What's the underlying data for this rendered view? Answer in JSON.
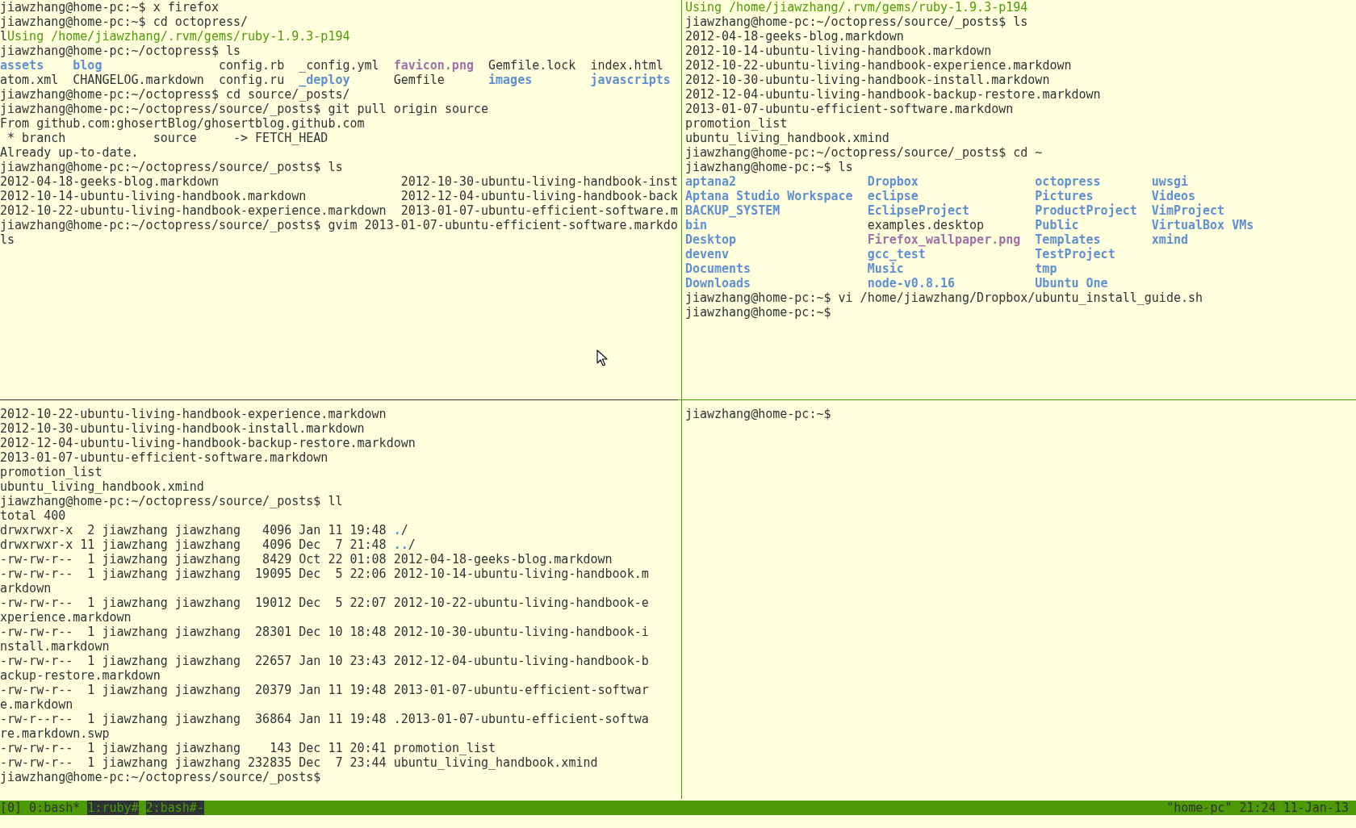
{
  "panes": {
    "top_left": [
      {
        "segments": [
          {
            "text": "jiawzhang@home-pc:~$ x firefox",
            "kind": "plain"
          }
        ]
      },
      {
        "segments": [
          {
            "text": "jiawzhang@home-pc:~$ cd octopress/",
            "kind": "plain"
          }
        ]
      },
      {
        "segments": [
          {
            "text": "l",
            "kind": "plain"
          },
          {
            "text": "Using /home/jiawzhang/.rvm/gems/ruby-1.9.3-p194",
            "kind": "ruby"
          }
        ]
      },
      {
        "segments": [
          {
            "text": "jiawzhang@home-pc:~/octopress$ ls",
            "kind": "plain"
          }
        ]
      },
      {
        "columns": [
          [
            {
              "text": "assets",
              "kind": "dir"
            },
            {
              "text": "atom.xml",
              "kind": "file"
            }
          ],
          [
            {
              "text": "blog",
              "kind": "dir"
            },
            {
              "text": "CHANGELOG.markdown",
              "kind": "file"
            }
          ],
          [
            {
              "text": "config.rb",
              "kind": "file"
            },
            {
              "text": "config.ru",
              "kind": "file"
            }
          ],
          [
            {
              "text": "_config.yml",
              "kind": "file"
            },
            {
              "text": "_deploy",
              "kind": "dir"
            }
          ],
          [
            {
              "text": "favicon.png",
              "kind": "image"
            },
            {
              "text": "Gemfile",
              "kind": "file"
            }
          ],
          [
            {
              "text": "Gemfile.lock",
              "kind": "file"
            },
            {
              "text": "images",
              "kind": "dir"
            }
          ],
          [
            {
              "text": "index.html",
              "kind": "file"
            },
            {
              "text": "javascripts",
              "kind": "dir"
            }
          ]
        ]
      },
      {
        "segments": [
          {
            "text": "jiawzhang@home-pc:~/octopress$ cd source/_posts/",
            "kind": "plain"
          }
        ]
      },
      {
        "segments": [
          {
            "text": "jiawzhang@home-pc:~/octopress/source/_posts$ git pull origin source",
            "kind": "plain"
          }
        ]
      },
      {
        "segments": [
          {
            "text": "From github.com:ghosertBlog/ghosertblog.github.com",
            "kind": "plain"
          }
        ]
      },
      {
        "segments": [
          {
            "text": " * branch            source     -> FETCH_HEAD",
            "kind": "plain"
          }
        ]
      },
      {
        "segments": [
          {
            "text": "Already up-to-date.",
            "kind": "plain"
          }
        ]
      },
      {
        "segments": [
          {
            "text": "jiawzhang@home-pc:~/octopress/source/_posts$ ls",
            "kind": "plain"
          }
        ]
      },
      {
        "columns": [
          [
            {
              "text": "2012-04-18-geeks-blog.markdown",
              "kind": "file"
            },
            {
              "text": "2012-10-14-ubuntu-living-handbook.markdown",
              "kind": "file"
            },
            {
              "text": "2012-10-22-ubuntu-living-handbook-experience.markdown",
              "kind": "file"
            }
          ],
          [
            {
              "text": "2012-10-30-ubuntu-living-handbook-inst",
              "kind": "file"
            },
            {
              "text": "2012-12-04-ubuntu-living-handbook-back",
              "kind": "file"
            },
            {
              "text": "2013-01-07-ubuntu-efficient-software.m",
              "kind": "file"
            }
          ]
        ]
      },
      {
        "segments": [
          {
            "text": "jiawzhang@home-pc:~/octopress/source/_posts$ gvim 2013-01-07-ubuntu-efficient-software.markdo",
            "kind": "plain"
          }
        ]
      },
      {
        "segments": [
          {
            "text": "ls",
            "kind": "plain"
          }
        ]
      }
    ],
    "top_right": [
      {
        "segments": [
          {
            "text": "Using /home/jiawzhang/.rvm/gems/ruby-1.9.3-p194",
            "kind": "ruby"
          }
        ]
      },
      {
        "segments": [
          {
            "text": "jiawzhang@home-pc:~/octopress/source/_posts$ ls",
            "kind": "plain"
          }
        ]
      },
      {
        "segments": [
          {
            "text": "2012-04-18-geeks-blog.markdown",
            "kind": "plain"
          }
        ]
      },
      {
        "segments": [
          {
            "text": "2012-10-14-ubuntu-living-handbook.markdown",
            "kind": "plain"
          }
        ]
      },
      {
        "segments": [
          {
            "text": "2012-10-22-ubuntu-living-handbook-experience.markdown",
            "kind": "plain"
          }
        ]
      },
      {
        "segments": [
          {
            "text": "2012-10-30-ubuntu-living-handbook-install.markdown",
            "kind": "plain"
          }
        ]
      },
      {
        "segments": [
          {
            "text": "2012-12-04-ubuntu-living-handbook-backup-restore.markdown",
            "kind": "plain"
          }
        ]
      },
      {
        "segments": [
          {
            "text": "2013-01-07-ubuntu-efficient-software.markdown",
            "kind": "plain"
          }
        ]
      },
      {
        "segments": [
          {
            "text": "promotion_list",
            "kind": "plain"
          }
        ]
      },
      {
        "segments": [
          {
            "text": "ubuntu_living_handbook.xmind",
            "kind": "plain"
          }
        ]
      },
      {
        "segments": [
          {
            "text": "jiawzhang@home-pc:~/octopress/source/_posts$ cd ~",
            "kind": "plain"
          }
        ]
      },
      {
        "segments": [
          {
            "text": "jiawzhang@home-pc:~$ ls",
            "kind": "plain"
          }
        ]
      },
      {
        "columns": [
          [
            {
              "text": "aptana2",
              "kind": "dir"
            },
            {
              "text": "Aptana Studio Workspace",
              "kind": "dir"
            },
            {
              "text": "BACKUP_SYSTEM",
              "kind": "dir"
            },
            {
              "text": "bin",
              "kind": "dir"
            },
            {
              "text": "Desktop",
              "kind": "dir"
            },
            {
              "text": "devenv",
              "kind": "dir"
            },
            {
              "text": "Documents",
              "kind": "dir"
            },
            {
              "text": "Downloads",
              "kind": "dir"
            }
          ],
          [
            {
              "text": "Dropbox",
              "kind": "dir"
            },
            {
              "text": "eclipse",
              "kind": "dir"
            },
            {
              "text": "EclipseProject",
              "kind": "dir"
            },
            {
              "text": "examples.desktop",
              "kind": "file"
            },
            {
              "text": "Firefox_wallpaper.png",
              "kind": "image"
            },
            {
              "text": "gcc_test",
              "kind": "dir"
            },
            {
              "text": "Music",
              "kind": "dir"
            },
            {
              "text": "node-v0.8.16",
              "kind": "dir"
            }
          ],
          [
            {
              "text": "octopress",
              "kind": "dir"
            },
            {
              "text": "Pictures",
              "kind": "dir"
            },
            {
              "text": "ProductProject",
              "kind": "dir"
            },
            {
              "text": "Public",
              "kind": "dir"
            },
            {
              "text": "Templates",
              "kind": "dir"
            },
            {
              "text": "TestProject",
              "kind": "dir"
            },
            {
              "text": "tmp",
              "kind": "dir"
            },
            {
              "text": "Ubuntu One",
              "kind": "dir"
            }
          ],
          [
            {
              "text": "uwsgi",
              "kind": "dir"
            },
            {
              "text": "Videos",
              "kind": "dir"
            },
            {
              "text": "VimProject",
              "kind": "dir"
            },
            {
              "text": "VirtualBox VMs",
              "kind": "dir"
            },
            {
              "text": "xmind",
              "kind": "dir"
            }
          ]
        ]
      },
      {
        "segments": [
          {
            "text": "jiawzhang@home-pc:~$ vi /home/jiawzhang/Dropbox/ubuntu_install_guide.sh",
            "kind": "plain"
          }
        ]
      },
      {
        "segments": [
          {
            "text": "jiawzhang@home-pc:~$",
            "kind": "plain"
          }
        ]
      }
    ],
    "bottom_left": [
      {
        "segments": [
          {
            "text": "2012-10-22-ubuntu-living-handbook-experience.markdown",
            "kind": "plain"
          }
        ]
      },
      {
        "segments": [
          {
            "text": "2012-10-30-ubuntu-living-handbook-install.markdown",
            "kind": "plain"
          }
        ]
      },
      {
        "segments": [
          {
            "text": "2012-12-04-ubuntu-living-handbook-backup-restore.markdown",
            "kind": "plain"
          }
        ]
      },
      {
        "segments": [
          {
            "text": "2013-01-07-ubuntu-efficient-software.markdown",
            "kind": "plain"
          }
        ]
      },
      {
        "segments": [
          {
            "text": "promotion_list",
            "kind": "plain"
          }
        ]
      },
      {
        "segments": [
          {
            "text": "ubuntu_living_handbook.xmind",
            "kind": "plain"
          }
        ]
      },
      {
        "segments": [
          {
            "text": "jiawzhang@home-pc:~/octopress/source/_posts$ ll",
            "kind": "plain"
          }
        ]
      },
      {
        "segments": [
          {
            "text": "total 400",
            "kind": "plain"
          }
        ]
      },
      {
        "segments": [
          {
            "text": "drwxrwxr-x  2 jiawzhang jiawzhang   4096 Jan 11 19:48 ",
            "kind": "plain"
          },
          {
            "text": ".",
            "kind": "dir"
          },
          {
            "text": "/",
            "kind": "plain"
          }
        ]
      },
      {
        "segments": [
          {
            "text": "drwxrwxr-x 11 jiawzhang jiawzhang   4096 Dec  7 21:48 ",
            "kind": "plain"
          },
          {
            "text": "..",
            "kind": "dir"
          },
          {
            "text": "/",
            "kind": "plain"
          }
        ]
      },
      {
        "segments": [
          {
            "text": "-rw-rw-r--  1 jiawzhang jiawzhang   8429 Oct 22 01:08 2012-04-18-geeks-blog.markdown",
            "kind": "plain"
          }
        ]
      },
      {
        "segments": [
          {
            "text": "-rw-rw-r--  1 jiawzhang jiawzhang  19095 Dec  5 22:06 2012-10-14-ubuntu-living-handbook.m",
            "kind": "plain"
          }
        ]
      },
      {
        "segments": [
          {
            "text": "arkdown",
            "kind": "plain"
          }
        ]
      },
      {
        "segments": [
          {
            "text": "-rw-rw-r--  1 jiawzhang jiawzhang  19012 Dec  5 22:07 2012-10-22-ubuntu-living-handbook-e",
            "kind": "plain"
          }
        ]
      },
      {
        "segments": [
          {
            "text": "xperience.markdown",
            "kind": "plain"
          }
        ]
      },
      {
        "segments": [
          {
            "text": "-rw-rw-r--  1 jiawzhang jiawzhang  28301 Dec 10 18:48 2012-10-30-ubuntu-living-handbook-i",
            "kind": "plain"
          }
        ]
      },
      {
        "segments": [
          {
            "text": "nstall.markdown",
            "kind": "plain"
          }
        ]
      },
      {
        "segments": [
          {
            "text": "-rw-rw-r--  1 jiawzhang jiawzhang  22657 Jan 10 23:43 2012-12-04-ubuntu-living-handbook-b",
            "kind": "plain"
          }
        ]
      },
      {
        "segments": [
          {
            "text": "ackup-restore.markdown",
            "kind": "plain"
          }
        ]
      },
      {
        "segments": [
          {
            "text": "-rw-rw-r--  1 jiawzhang jiawzhang  20379 Jan 11 19:48 2013-01-07-ubuntu-efficient-softwar",
            "kind": "plain"
          }
        ]
      },
      {
        "segments": [
          {
            "text": "e.markdown",
            "kind": "plain"
          }
        ]
      },
      {
        "segments": [
          {
            "text": "-rw-r--r--  1 jiawzhang jiawzhang  36864 Jan 11 19:48 .2013-01-07-ubuntu-efficient-softwa",
            "kind": "plain"
          }
        ]
      },
      {
        "segments": [
          {
            "text": "re.markdown.swp",
            "kind": "plain"
          }
        ]
      },
      {
        "segments": [
          {
            "text": "-rw-rw-r--  1 jiawzhang jiawzhang    143 Dec 11 20:41 promotion_list",
            "kind": "plain"
          }
        ]
      },
      {
        "segments": [
          {
            "text": "-rw-rw-r--  1 jiawzhang jiawzhang 232835 Dec  7 23:44 ubuntu_living_handbook.xmind",
            "kind": "plain"
          }
        ]
      },
      {
        "segments": [
          {
            "text": "jiawzhang@home-pc:~/octopress/source/_posts$",
            "kind": "plain"
          }
        ]
      }
    ],
    "bottom_right": [
      {
        "segments": [
          {
            "text": "jiawzhang@home-pc:~$",
            "kind": "plain"
          }
        ]
      }
    ]
  },
  "status_bar": {
    "session": "[0]",
    "windows": [
      {
        "label": "0:bash*",
        "selected": true
      },
      {
        "label": "1:ruby#",
        "selected": false
      },
      {
        "label": "2:bash#-",
        "selected": false
      }
    ],
    "right": "\"home-pc\" 21:24 11-Jan-13"
  }
}
